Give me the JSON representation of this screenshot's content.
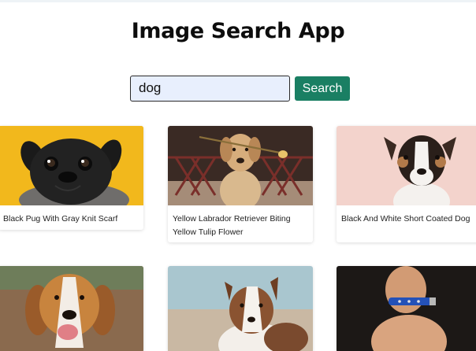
{
  "app": {
    "title": "Image Search App"
  },
  "search": {
    "value": "dog",
    "button_label": "Search"
  },
  "results": [
    {
      "caption": "Black Pug With Gray Knit Scarf",
      "bg": "#f2b81c"
    },
    {
      "caption": "Yellow Labrador Retriever Biting Yellow Tulip Flower",
      "bg": "#3a2a24"
    },
    {
      "caption": "Black And White Short Coated Dog",
      "bg": "#f3d3cc"
    },
    {
      "caption": "",
      "bg": "#8a6a4e"
    },
    {
      "caption": "",
      "bg": "#a9c6cf"
    },
    {
      "caption": "",
      "bg": "#1c1816"
    }
  ],
  "colors": {
    "accent": "#1a7f63",
    "input_bg": "#e8effd"
  }
}
